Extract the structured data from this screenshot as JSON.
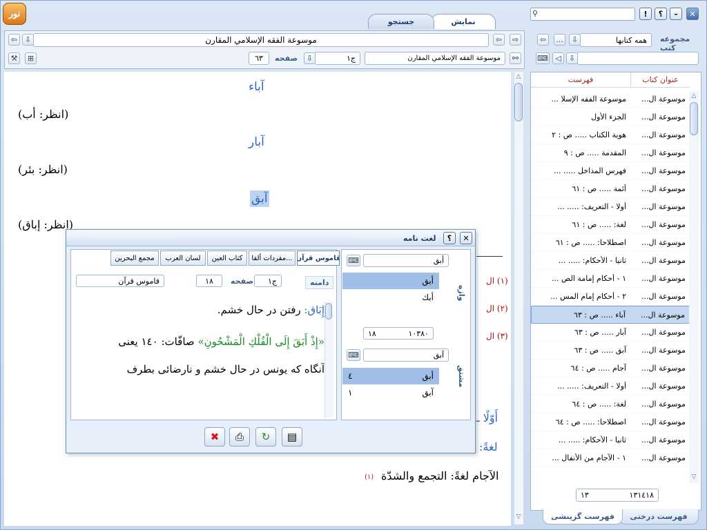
{
  "app": {
    "logo_text": "نور"
  },
  "tabs": {
    "display": "نمایش",
    "search": "جستجو"
  },
  "window_buttons": {
    "help": "؟",
    "info": "!",
    "minimize": "–",
    "close": "✕"
  },
  "right_header": {
    "label": "مجموعه کتب",
    "collection_value": "همه کتابها",
    "more": "..."
  },
  "top": {
    "book_title": "موسوعة الفقه الإسلامي المقارن",
    "book_field": "موسوعة الفقه الإسلامي المقارن",
    "volume": "ج۱",
    "page_label": "صفحه",
    "page_value": "٦٣"
  },
  "content": {
    "h1": "آباء",
    "p1": "(انظر: أب)",
    "h2": "آبار",
    "p2": "(انظر: بئر)",
    "h3": "آبق",
    "p3": "(انظر: إباق)",
    "fn1": "(١) ال",
    "fn2": "(٢) ال",
    "fn3": "(٣) ال",
    "side1": "أَوّلًا ـ",
    "side2": "لغةً:",
    "last_line": "الآجام لغةً: التجمع والشدّة",
    "last_ref": "(١)"
  },
  "right_panel": {
    "col_title": "عنوان كتاب",
    "col_index": "فهرست",
    "rows": [
      {
        "a": "موسوعة ال...",
        "b": "موسوعة الفقه الإسلا ..."
      },
      {
        "a": "موسوعة ال...",
        "b": "الجزء الأول"
      },
      {
        "a": "موسوعة ال...",
        "b": "هوية الكتاب ..... ص : ٢"
      },
      {
        "a": "موسوعة ال...",
        "b": "المقدمة ..... ص : ٩"
      },
      {
        "a": "موسوعة ال...",
        "b": "فهرس المداخل ..... ..."
      },
      {
        "a": "موسوعة ال...",
        "b": "أئمة ..... ص : ٦١"
      },
      {
        "a": "موسوعة ال...",
        "b": "أولا - التعريف: ..... ..."
      },
      {
        "a": "موسوعة ال...",
        "b": "لغة: ..... ص : ٦١"
      },
      {
        "a": "موسوعة ال...",
        "b": "اصطلاحا: ..... ص : ٦١"
      },
      {
        "a": "موسوعة ال...",
        "b": "ثانيا - الأحكام: ..... ..."
      },
      {
        "a": "موسوعة ال...",
        "b": "١ - أحكام إمامة الص ..."
      },
      {
        "a": "موسوعة ال...",
        "b": "٢ - أحكام إمام المس ..."
      },
      {
        "a": "موسوعة ال...",
        "b": "آباء ..... ص : ٦٣"
      },
      {
        "a": "موسوعة ال...",
        "b": "آبار ..... ص : ٦٣"
      },
      {
        "a": "موسوعة ال...",
        "b": "آبق ..... ص : ٦٣"
      },
      {
        "a": "موسوعة ال...",
        "b": "آجام ..... ص : ٦٤"
      },
      {
        "a": "موسوعة ال...",
        "b": "أولا - التعريف: ..... ..."
      },
      {
        "a": "موسوعة ال...",
        "b": "لغة: ..... ص : ٦٤"
      },
      {
        "a": "موسوعة ال...",
        "b": "اصطلاحا: ..... ص : ٦٤"
      },
      {
        "a": "موسوعة ال...",
        "b": "ثانيا - الأحكام: ..... ..."
      },
      {
        "a": "موسوعة ال...",
        "b": "١ - الآجام من الأنفال ..."
      }
    ],
    "selected_index": 12,
    "footer_left": "١٣",
    "footer_right": "١٣١٤١٨",
    "tab_tree": "فهرست درختی",
    "tab_selective": "فهرست گزینشی"
  },
  "dialog": {
    "title": "لغت نامه",
    "help": "؟",
    "close": "✕",
    "dict_tabs": [
      "قاموس قرآن",
      "مفردات ألفا...",
      "كتاب العين",
      "لسان العرب",
      "مجمع البحرين"
    ],
    "label_domain": "دامنه",
    "volume": "ج۱",
    "page_label": "صفحه",
    "page_value": "١٨",
    "dict_name": "قاموس قرآن",
    "search1": "أبق",
    "list1": [
      {
        "w": "أبق"
      },
      {
        "w": "أبك"
      }
    ],
    "counter_left": "١٨",
    "counter_right": "١٠٣٨٠",
    "search2": "آبق",
    "list2": [
      {
        "w": "أبق",
        "n": "٤"
      },
      {
        "w": "آبق",
        "n": "١"
      }
    ],
    "side_label1": "واژه",
    "side_label2": "مشتق",
    "entry_head": "إِبَاق:",
    "entry_line1": "رفتن در حال خشم.",
    "entry_quran": "«إِذْ أَبَقَ إِلَى الْفُلْكِ الْمَشْحُونِ»",
    "entry_line2a": "صافّات: ١٤٠ يعنى",
    "entry_line3": "آنگاه كه يونس در حال خشم و نارضائى بطرف"
  }
}
